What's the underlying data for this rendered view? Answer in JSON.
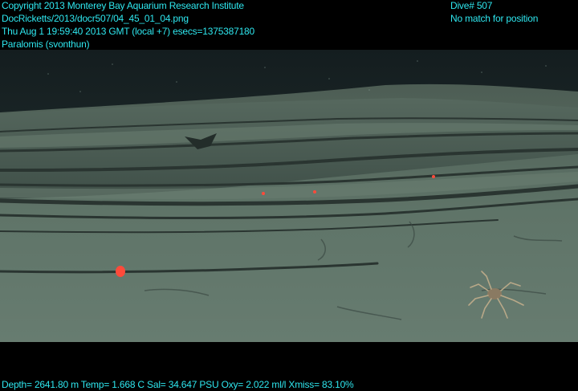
{
  "overlay": {
    "copyright": "Copyright 2013 Monterey Bay Aquarium Research Institute",
    "file_path": "DocRicketts/2013/docr507/04_45_01_04.png",
    "timestamp": "Thu Aug  1 19:59:40 2013 GMT (local +7)  esecs=1375387180",
    "species": "Paralomis (svonthun)",
    "dive": "Dive# 507",
    "position_status": "No match for position",
    "telemetry": "Depth= 2641.80 m  Temp= 1.668 C  Sal= 34.647 PSU  Oxy= 2.022 ml/l  Xmiss= 83.10%"
  },
  "colors": {
    "overlay_text": "#2ee6ee",
    "water": "#1c2c2a",
    "sediment": "#5e7266",
    "red_animal": "#ff4a3a"
  }
}
